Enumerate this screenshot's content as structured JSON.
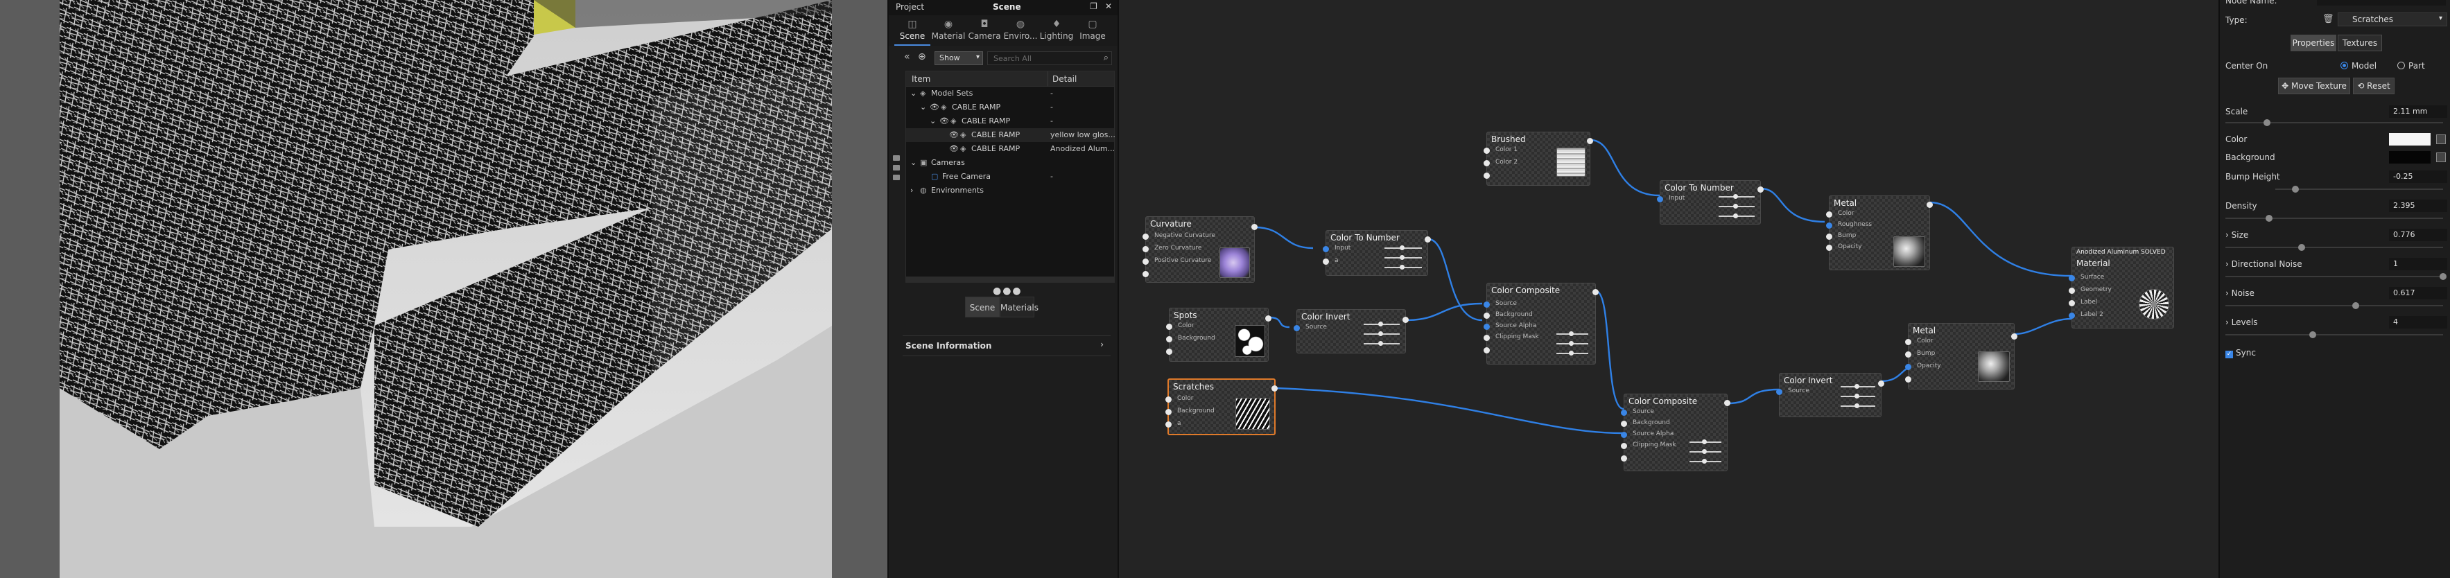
{
  "scene_panel": {
    "title_left": "Project",
    "title_center": "Scene",
    "tabs": [
      {
        "label": "Scene",
        "icon": "◫"
      },
      {
        "label": "Material",
        "icon": "◉"
      },
      {
        "label": "Camera",
        "icon": "◘"
      },
      {
        "label": "Enviro...",
        "icon": "◍"
      },
      {
        "label": "Lighting",
        "icon": "♦"
      },
      {
        "label": "Image",
        "icon": "▢"
      }
    ],
    "show_label": "Show",
    "search_placeholder": "Search All",
    "columns": {
      "item": "Item",
      "detail": "Detail"
    },
    "tree": [
      {
        "label": "Model Sets",
        "detail": "-"
      },
      {
        "label": "CABLE RAMP",
        "detail": "-"
      },
      {
        "label": "CABLE RAMP",
        "detail": "-"
      },
      {
        "label": "CABLE RAMP",
        "detail": "yellow low glos..."
      },
      {
        "label": "CABLE RAMP",
        "detail": "Anodized Alum..."
      },
      {
        "label": "Cameras",
        "detail": "-"
      },
      {
        "label": "Free Camera",
        "detail": "-"
      },
      {
        "label": "Environments",
        "detail": ""
      }
    ],
    "bottom_tabs": [
      "Scene",
      "Materials"
    ],
    "scene_info": "Scene Information"
  },
  "graph": {
    "nodes": {
      "brushed": {
        "title": "Brushed",
        "inputs": [
          "Color 1",
          "Color 2"
        ]
      },
      "curvature": {
        "title": "Curvature",
        "inputs": [
          "Negative Curvature",
          "Zero Curvature",
          "Positive Curvature"
        ]
      },
      "ctn1": {
        "title": "Color To Number",
        "inputs": [
          "Input",
          "a"
        ]
      },
      "ctn2": {
        "title": "Color To Number",
        "inputs": [
          "Input"
        ]
      },
      "metal1": {
        "title": "Metal",
        "inputs": [
          "Color",
          "Roughness",
          "Bump",
          "Opacity"
        ]
      },
      "spots": {
        "title": "Spots",
        "inputs": [
          "Color",
          "Background"
        ]
      },
      "ci1": {
        "title": "Color Invert",
        "inputs": [
          "Source"
        ]
      },
      "cc1": {
        "title": "Color Composite",
        "inputs": [
          "Source",
          "Background",
          "Source Alpha",
          "Clipping Mask"
        ]
      },
      "scratches": {
        "title": "Scratches",
        "inputs": [
          "Color",
          "Background",
          "a"
        ]
      },
      "cc2": {
        "title": "Color Composite",
        "inputs": [
          "Source",
          "Background",
          "Source Alpha",
          "Clipping Mask"
        ]
      },
      "ci2": {
        "title": "Color Invert",
        "inputs": [
          "Source"
        ]
      },
      "metal2": {
        "title": "Metal",
        "inputs": [
          "Color",
          "Bump",
          "Opacity"
        ]
      },
      "material": {
        "title": "Anodized Aluminum SOLVED",
        "subtitle": "Material",
        "inputs": [
          "Surface",
          "Geometry",
          "Label",
          "Label 2"
        ]
      }
    }
  },
  "properties": {
    "node_name_label": "Node Name:",
    "type_label": "Type:",
    "type_value": "Scratches",
    "tab_properties": "Properties",
    "tab_textures": "Textures",
    "center_on_label": "Center On",
    "center_model": "Model",
    "center_part": "Part",
    "move_texture": "Move Texture",
    "reset": "Reset",
    "scale_label": "Scale",
    "scale_value": "2.11 mm",
    "scale_level": 0.19,
    "color_label": "Color",
    "color_value": "#f5f5f5",
    "background_label": "Background",
    "background_value": "#050505",
    "bump_label": "Bump Height",
    "bump_value": "-0.25",
    "bump_level": 0.12,
    "density_label": "Density",
    "density_value": "2.395",
    "density_level": 0.2,
    "size_label": "Size",
    "size_value": "0.776",
    "size_level": 0.35,
    "dnoise_label": "Directional Noise",
    "dnoise_value": "1",
    "dnoise_level": 1.0,
    "noise_label": "Noise",
    "noise_value": "0.617",
    "noise_level": 0.6,
    "levels_label": "Levels",
    "levels_value": "4",
    "levels_level": 0.4,
    "sync_label": "Sync"
  }
}
